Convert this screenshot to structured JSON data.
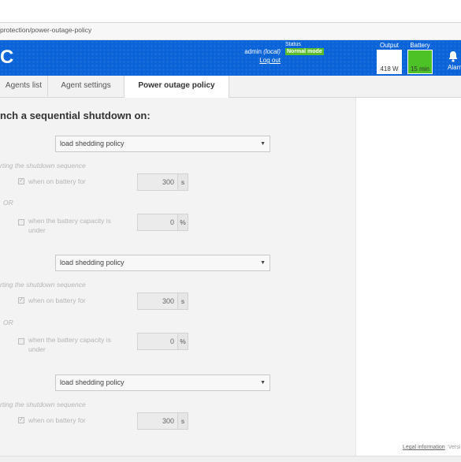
{
  "browser": {
    "url": "protection/power-outage-policy"
  },
  "header": {
    "brand": "C",
    "user": {
      "name": "admin",
      "realm": "(local)",
      "logout": "Log out"
    },
    "status": {
      "label": "Status",
      "badge": "Normal mode",
      "badge_color": "#5bbd2b"
    },
    "output": {
      "label": "Output",
      "value": "418 W"
    },
    "battery": {
      "label": "Battery",
      "value": "15 min",
      "color": "#4cc227"
    },
    "alarms": {
      "label": "Alarms"
    }
  },
  "tabs": [
    "Agents list",
    "Agent settings",
    "Power outage policy"
  ],
  "panel": {
    "title": "nch a sequential shutdown on:",
    "groups": [
      {
        "select": "load shedding policy",
        "hint": "rting the shutdown sequence",
        "battery_label": "when on battery for",
        "battery_value": "300",
        "battery_unit": "s",
        "or": "OR",
        "capacity_label_1": "when the battery capacity is",
        "capacity_label_2": "under",
        "capacity_value": "0",
        "capacity_unit": "%"
      },
      {
        "select": "load shedding policy",
        "hint": "rting the shutdown sequence",
        "battery_label": "when on battery for",
        "battery_value": "300",
        "battery_unit": "s",
        "or": "OR",
        "capacity_label_1": "when the battery capacity is",
        "capacity_label_2": "under",
        "capacity_value": "0",
        "capacity_unit": "%"
      },
      {
        "select": "load shedding policy",
        "hint": "rting the shutdown sequence",
        "battery_label": "when on battery for",
        "battery_value": "300",
        "battery_unit": "s"
      }
    ]
  },
  "footer": {
    "legal": "Legal information",
    "version": "Versi"
  }
}
